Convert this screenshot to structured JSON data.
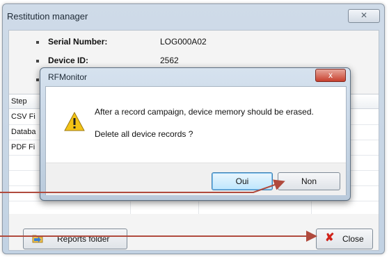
{
  "window": {
    "title": "Restitution manager",
    "close_glyph": "✕",
    "info": [
      {
        "label": "Serial Number:",
        "value": "LOG000A02"
      },
      {
        "label": "Device ID:",
        "value": "2562"
      },
      {
        "label": "",
        "value": ""
      }
    ],
    "grid": {
      "header": "Step",
      "rows": [
        "CSV Fi",
        "Databa",
        "PDF Fi"
      ]
    },
    "reports_button": {
      "label": "Reports folder",
      "icon": "folder-icon"
    },
    "close_button": {
      "label": "Close",
      "icon": "close-x-icon",
      "glyph": "✘"
    }
  },
  "dialog": {
    "title": "RFMonitor",
    "close_glyph": "x",
    "icon": "warning-icon",
    "message_line1": "After a record campaign, device memory should be erased.",
    "message_line2": "Delete all device records ?",
    "buttons": {
      "yes": "Oui",
      "no": "Non"
    }
  },
  "annotation": {
    "arrow_color": "#b04a3d"
  }
}
